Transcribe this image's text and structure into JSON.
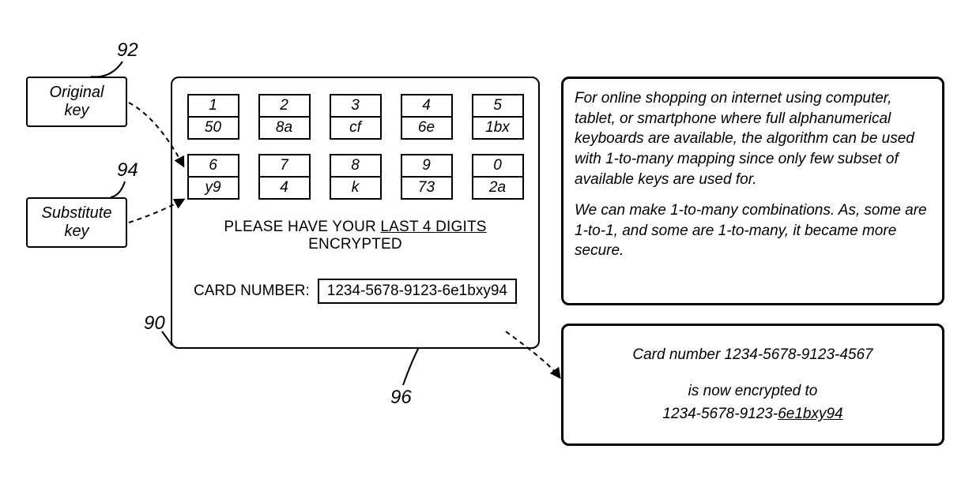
{
  "refs": {
    "r90": "90",
    "r92": "92",
    "r94": "94",
    "r96": "96"
  },
  "labels": {
    "original_key_l1": "Original",
    "original_key_l2": "key",
    "substitute_key_l1": "Substitute",
    "substitute_key_l2": "key"
  },
  "keypad": {
    "rows": [
      [
        {
          "orig": "1",
          "sub": "50"
        },
        {
          "orig": "2",
          "sub": "8a"
        },
        {
          "orig": "3",
          "sub": "cf"
        },
        {
          "orig": "4",
          "sub": "6e"
        },
        {
          "orig": "5",
          "sub": "1bx"
        }
      ],
      [
        {
          "orig": "6",
          "sub": "y9"
        },
        {
          "orig": "7",
          "sub": "4"
        },
        {
          "orig": "8",
          "sub": "k"
        },
        {
          "orig": "9",
          "sub": "73"
        },
        {
          "orig": "0",
          "sub": "2a"
        }
      ]
    ]
  },
  "prompt": {
    "pre": "PLEASE HAVE YOUR ",
    "under": "LAST 4 DIGITS",
    "post": " ENCRYPTED"
  },
  "card": {
    "label": "CARD NUMBER:",
    "value": "1234-5678-9123-6e1bxy94"
  },
  "desc": {
    "p1": "For online shopping on internet using computer, tablet, or smartphone where full alphanumerical keyboards are available, the algorithm can be used with 1-to-many mapping since only few subset of available keys are used for.",
    "p2": "We can make 1-to-many combinations. As, some are 1-to-1, and some are 1-to-many, it became more secure."
  },
  "enc": {
    "line1": "Card number 1234-5678-9123-4567",
    "line2": "is now encrypted to",
    "line3_pre": "1234-5678-9123-",
    "line3_under": "6e1bxy94"
  }
}
